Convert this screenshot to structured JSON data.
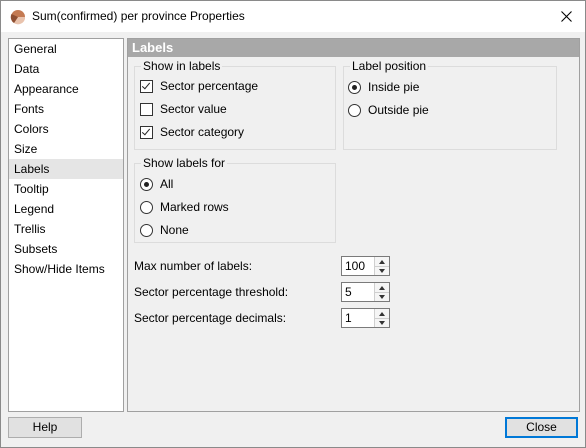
{
  "window": {
    "title": "Sum(confirmed) per province Properties"
  },
  "sidebar": {
    "items": [
      {
        "label": "General"
      },
      {
        "label": "Data"
      },
      {
        "label": "Appearance"
      },
      {
        "label": "Fonts"
      },
      {
        "label": "Colors"
      },
      {
        "label": "Size"
      },
      {
        "label": "Labels",
        "selected": true
      },
      {
        "label": "Tooltip"
      },
      {
        "label": "Legend"
      },
      {
        "label": "Trellis"
      },
      {
        "label": "Subsets"
      },
      {
        "label": "Show/Hide Items"
      }
    ]
  },
  "panel": {
    "header": "Labels",
    "show_in_labels": {
      "title": "Show in labels",
      "options": [
        {
          "label": "Sector percentage",
          "checked": true
        },
        {
          "label": "Sector value",
          "checked": false
        },
        {
          "label": "Sector category",
          "checked": true
        }
      ]
    },
    "label_position": {
      "title": "Label position",
      "options": [
        {
          "label": "Inside pie",
          "selected": true
        },
        {
          "label": "Outside pie",
          "selected": false
        }
      ]
    },
    "show_labels_for": {
      "title": "Show labels for",
      "options": [
        {
          "label": "All",
          "selected": true
        },
        {
          "label": "Marked rows",
          "selected": false
        },
        {
          "label": "None",
          "selected": false
        }
      ]
    },
    "fields": [
      {
        "label": "Max number of labels:",
        "value": "100"
      },
      {
        "label": "Sector percentage threshold:",
        "value": "5"
      },
      {
        "label": "Sector percentage decimals:",
        "value": "1"
      }
    ]
  },
  "buttons": {
    "help": "Help",
    "close": "Close"
  },
  "colors": {
    "panel_header": "#a8a8a8",
    "default_button_border": "#0078d7",
    "app_icon": "#c47a52"
  }
}
